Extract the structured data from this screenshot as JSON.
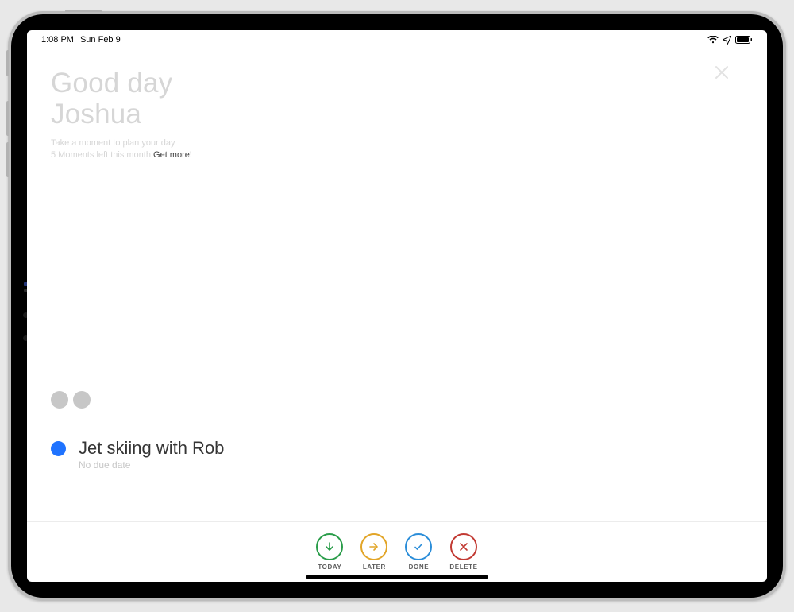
{
  "status": {
    "time": "1:08 PM",
    "date": "Sun Feb 9"
  },
  "header": {
    "greeting_line1": "Good day",
    "greeting_line2": "Joshua",
    "subtitle": "Take a moment to plan your day",
    "moments_left": "5 Moments left this month",
    "get_more": "Get more!"
  },
  "task": {
    "title": "Jet skiing with Rob",
    "subtitle": "No due date",
    "bullet_color": "#1f73ff"
  },
  "actions": {
    "today": {
      "label": "TODAY",
      "icon": "arrow-down",
      "color": "green"
    },
    "later": {
      "label": "LATER",
      "icon": "arrow-right",
      "color": "orange"
    },
    "done": {
      "label": "DONE",
      "icon": "check",
      "color": "blue"
    },
    "delete": {
      "label": "DELETE",
      "icon": "cross",
      "color": "red"
    }
  },
  "page_dots_count": 2
}
